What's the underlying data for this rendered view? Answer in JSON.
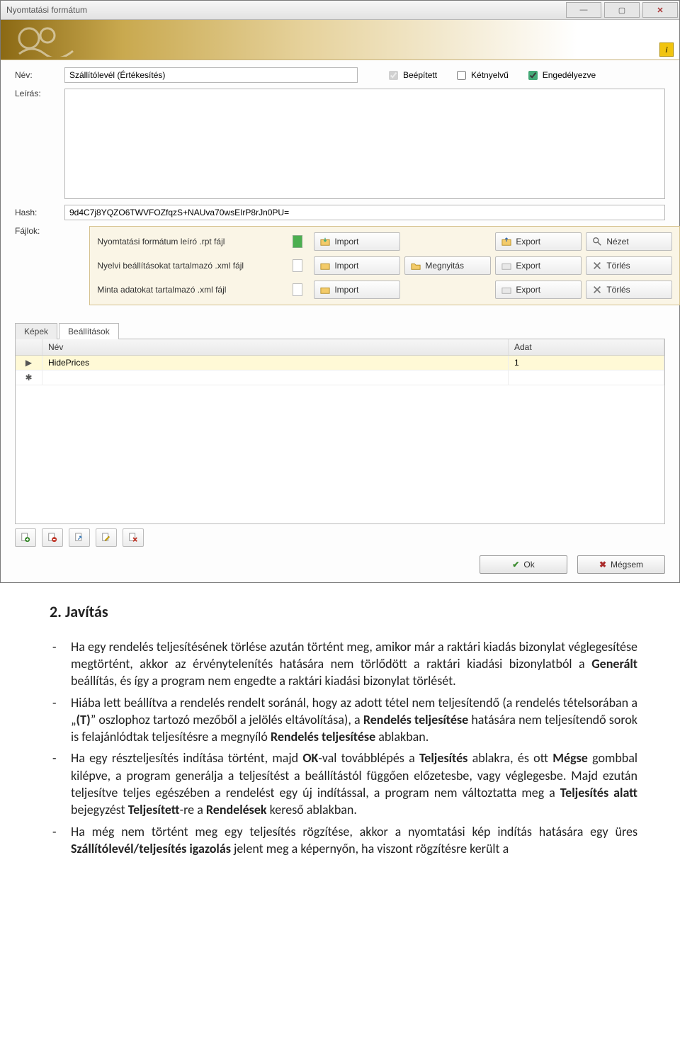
{
  "window": {
    "title": "Nyomtatási formátum"
  },
  "form": {
    "name_label": "Név:",
    "name_value": "Szállítólevél (Értékesítés)",
    "desc_label": "Leírás:",
    "desc_value": "",
    "hash_label": "Hash:",
    "hash_value": "9d4C7j8YQZO6TWVFOZfqzS+NAUva70wsEIrP8rJn0PU=",
    "files_label": "Fájlok:"
  },
  "checks": {
    "builtin": "Beépített",
    "bilingual": "Kétnyelvű",
    "enabled": "Engedélyezve"
  },
  "files": [
    {
      "desc": "Nyomtatási formátum leíró .rpt fájl",
      "full": true,
      "buttons": [
        "",
        "Import",
        "",
        "Export",
        "Nézet"
      ]
    },
    {
      "desc": "Nyelvi beállításokat tartalmazó .xml fájl",
      "full": false,
      "buttons": [
        "",
        "Import",
        "Megnyitás",
        "Export",
        "Törlés"
      ]
    },
    {
      "desc": "Minta adatokat tartalmazó .xml fájl",
      "full": false,
      "buttons": [
        "",
        "Import",
        "",
        "Export",
        "Törlés"
      ]
    }
  ],
  "file_buttons": {
    "import": "Import",
    "open": "Megnyitás",
    "export": "Export",
    "view": "Nézet",
    "delete": "Törlés"
  },
  "tabs": {
    "images": "Képek",
    "settings": "Beállítások"
  },
  "grid": {
    "col_name": "Név",
    "col_data": "Adat",
    "rows": [
      {
        "name": "HidePrices",
        "data": "1"
      }
    ]
  },
  "dialog": {
    "ok": "Ok",
    "cancel": "Mégsem"
  },
  "doc": {
    "heading": "2.   Javítás",
    "items": [
      "Ha egy rendelés teljesítésének törlése azután történt meg, amikor már a raktári kiadás bizonylat véglegesítése megtörtént, akkor az érvénytelenítés hatására nem törlődött a raktári kiadási bizonylatból a <b>Generált</b> beállítás, és így a program nem engedte a raktári kiadási bizonylat törlését.",
      "Hiába lett beállítva a rendelés rendelt soránál, hogy az adott tétel nem teljesítendő (a rendelés tételsorában a „<b>(T)</b>” oszlophoz tartozó mezőből a jelölés eltávolítása), a <b>Rendelés teljesítése</b> hatására nem teljesítendő sorok is felajánlódtak teljesítésre a megnyíló <b>Rendelés teljesítése</b> ablakban.",
      "Ha egy részteljesítés indítása történt, majd <b>OK</b>-val továbblépés a <b>Teljesítés</b> ablakra, és ott <b>Mégse</b> gombbal kilépve, a program generálja a teljesítést a beállítástól függően előzetesbe, vagy véglegesbe. Majd ezután teljesítve teljes egészében a rendelést egy új indítással, a program nem változtatta meg a <b>Teljesítés alatt</b> bejegyzést <b>Teljesített</b>-re a <b>Rendelések</b> kereső ablakban.",
      "Ha még nem történt meg egy teljesítés rögzítése, akkor a nyomtatási kép indítás hatására egy üres <b>Szállítólevél/teljesítés igazolás</b> jelent meg a képernyőn, ha viszont rögzítésre került a"
    ]
  }
}
